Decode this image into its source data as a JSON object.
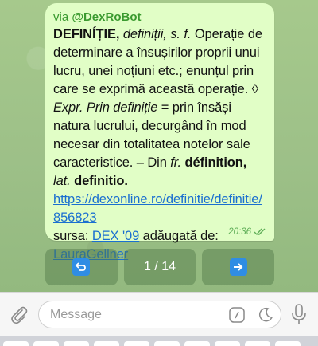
{
  "message": {
    "via_prefix": "via ",
    "bot_handle": "@DexRoBot",
    "headword": "DEFINÍȚIE,",
    "forms": " definiții, s. f.",
    "def1": " Operație de determinare a însușirilor proprii unui lucru, unei noțiuni etc.; enunțul prin care se exprimă această operație. ◊ ",
    "expr_label": "Expr. Prin definiție",
    "def2": " = prin însăși natura lucrului, decurgând în mod necesar din totalitatea notelor sale caracteristice. – Din ",
    "fr_label": "fr.",
    "fr_word": " définition,",
    "lat_label": " lat.",
    "lat_word": " definitio.",
    "url": "https://dexonline.ro/definitie/definitie/856823",
    "source_label": "sursa: ",
    "source_link": "DEX '09",
    "added_by": " adăugată de:",
    "author": "LauraGellner",
    "time": "20:36"
  },
  "keyboard_buttons": {
    "prev_icon": "back-arrow-icon",
    "page": "1 / 14",
    "next_icon": "right-arrow-icon"
  },
  "input": {
    "placeholder": "Message"
  },
  "colors": {
    "bubble": "#e1fec6",
    "link": "#1a6fd0",
    "bot_name": "#3a9a2f",
    "emoji_key": "#2f8de4"
  }
}
